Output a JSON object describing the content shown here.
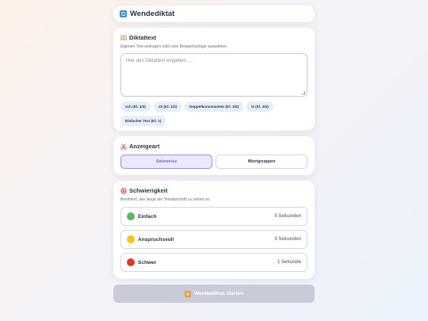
{
  "header": {
    "title": "Wendediktat",
    "icon": "refresh-icon"
  },
  "text_section": {
    "title": "Diktattext",
    "icon": "book-icon",
    "subtitle": "Eigenen Text eintragen oder eine Beispielvorlage auswählen.",
    "textarea_placeholder": "Hier den Diktattext eingeben ...",
    "textarea_value": "",
    "presets": [
      "sch (Kl. 1/2)",
      "ch (Kl. 1/2)",
      "Doppelkonsonanten (Kl. 3/4)",
      "tz (Kl. 3/4)",
      "Einfacher Text (Kl. 1)"
    ]
  },
  "mode_section": {
    "title": "Anzeigeart",
    "icon": "scissors-icon",
    "options": [
      "Satzweise",
      "Wortgruppen"
    ],
    "selected": "Satzweise"
  },
  "difficulty_section": {
    "title": "Schwierigkeit",
    "icon": "target-icon",
    "subtitle": "Bestimmt, wie lange der Textabschnitt zu sehen ist.",
    "levels": [
      {
        "label": "Einfach",
        "duration": "5 Sekunden",
        "color": "#5cb85c"
      },
      {
        "label": "Anspruchsvoll",
        "duration": "3 Sekunden",
        "color": "#f5c518"
      },
      {
        "label": "Schwer",
        "duration": "1 Sekunde",
        "color": "#e0392b"
      }
    ]
  },
  "start_button": {
    "label": "Wendediktat starten",
    "icon": "play-icon",
    "enabled": false
  },
  "colors": {
    "accent": "#7e6cd4",
    "accent_bg": "#ece8fb",
    "chip_bg": "#e6eefb",
    "disabled_button": "#c9cbd8"
  }
}
